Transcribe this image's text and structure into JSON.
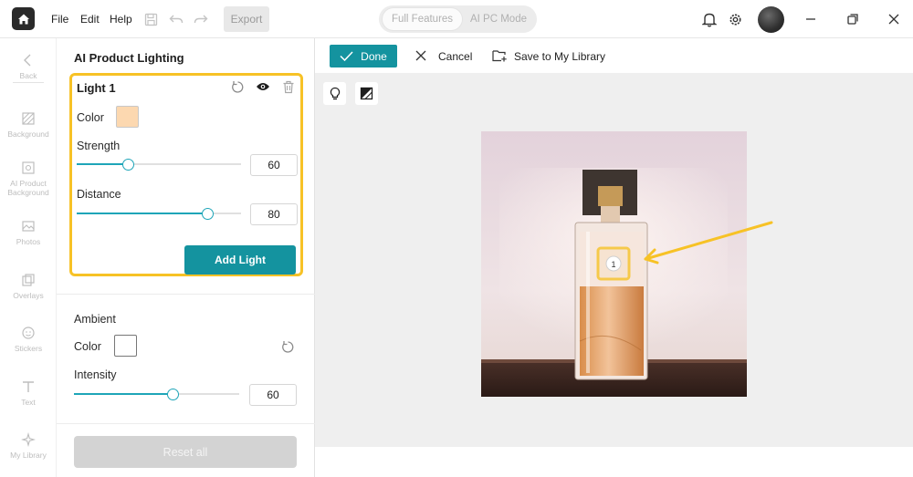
{
  "topbar": {
    "menu": [
      "File",
      "Edit",
      "Help"
    ],
    "export_label": "Export",
    "modes": [
      "Full Features",
      "AI PC Mode"
    ]
  },
  "rail": {
    "items": [
      {
        "label": "Back",
        "icon": "chevron-left-icon"
      },
      {
        "label": "Background",
        "icon": "background-icon"
      },
      {
        "label": "AI Product Background",
        "icon": "ai-product-background-icon"
      },
      {
        "label": "Photos",
        "icon": "photos-icon"
      },
      {
        "label": "Overlays",
        "icon": "overlays-icon"
      },
      {
        "label": "Stickers",
        "icon": "stickers-icon"
      },
      {
        "label": "Text",
        "icon": "text-icon"
      },
      {
        "label": "My Library",
        "icon": "sparkle-icon"
      }
    ]
  },
  "panel": {
    "title": "AI Product Lighting",
    "light": {
      "title": "Light 1",
      "color_label": "Color",
      "color": "#fcd8b0",
      "strength_label": "Strength",
      "strength": 60,
      "distance_label": "Distance",
      "distance": 80,
      "add_label": "Add Light"
    },
    "ambient": {
      "title": "Ambient",
      "color_label": "Color",
      "color": "#ffffff",
      "intensity_label": "Intensity",
      "intensity": 60
    },
    "reset_label": "Reset all"
  },
  "actions": {
    "done_label": "Done",
    "cancel_label": "Cancel",
    "save_label": "Save to My Library"
  },
  "canvas": {
    "marker_label": "1"
  },
  "colors": {
    "accent": "#14939f",
    "highlight": "#f7c226"
  }
}
